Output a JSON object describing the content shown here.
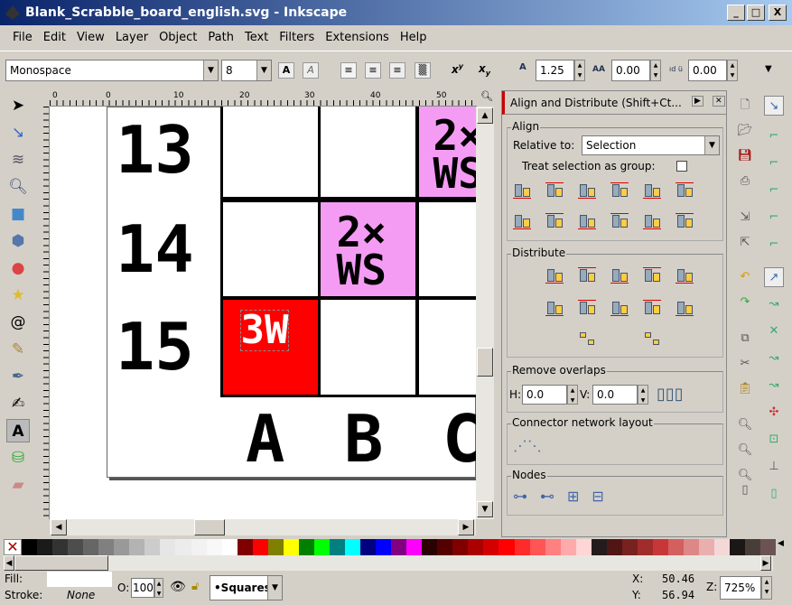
{
  "window": {
    "title": "Blank_Scrabble_board_english.svg - Inkscape",
    "min": "_",
    "max": "□",
    "close": "X"
  },
  "menu": [
    "File",
    "Edit",
    "View",
    "Layer",
    "Object",
    "Path",
    "Text",
    "Filters",
    "Extensions",
    "Help"
  ],
  "text_toolbar": {
    "font_family": "Monospace",
    "font_size": "8",
    "line_spacing": "1.25",
    "letter_spacing": "0.00",
    "word_spacing": "0.00",
    "superscript": "x",
    "subscript": "x"
  },
  "ruler": [
    "0",
    "0",
    "10",
    "20",
    "30",
    "40",
    "50"
  ],
  "canvas": {
    "rows": [
      "13",
      "14",
      "15"
    ],
    "columns": [
      "A",
      "B",
      "C"
    ],
    "cells": {
      "r13c": {
        "line1": "2×",
        "line2": "WS"
      },
      "r14b": {
        "line1": "2×",
        "line2": "WS"
      },
      "r15a": "3W"
    },
    "colors": {
      "pink": "#f49cf4",
      "red": "#ff0000"
    }
  },
  "dock": {
    "title": "Align and Distribute (Shift+Ct...",
    "align_label": "Align",
    "relative_to_label": "Relative to:",
    "relative_to_value": "Selection",
    "group_label": "Treat selection as group:",
    "distribute_label": "Distribute",
    "overlaps_label": "Remove overlaps",
    "h_label": "H:",
    "h_value": "0.0",
    "v_label": "V:",
    "v_value": "0.0",
    "connector_label": "Connector network layout",
    "nodes_label": "Nodes"
  },
  "palette": [
    "#000000",
    "#1a1a1a",
    "#333333",
    "#4d4d4d",
    "#666666",
    "#808080",
    "#999999",
    "#b3b3b3",
    "#cccccc",
    "#e6e6e6",
    "#ececec",
    "#f2f2f2",
    "#f8f8f8",
    "#ffffff",
    "#800000",
    "#ff0000",
    "#808000",
    "#ffff00",
    "#008000",
    "#00ff00",
    "#008080",
    "#00ffff",
    "#000080",
    "#0000ff",
    "#800080",
    "#ff00ff",
    "#2b0000",
    "#550000",
    "#800000",
    "#aa0000",
    "#d40000",
    "#ff0000",
    "#ff2a2a",
    "#ff5555",
    "#ff8080",
    "#ffaaaa",
    "#ffd5d5",
    "#241c1c",
    "#501616",
    "#782121",
    "#a02c2c",
    "#c83737",
    "#d35f5f",
    "#de8787",
    "#e9afaf",
    "#f4d7d7",
    "#1c1717",
    "#483e37",
    "#6c5353"
  ],
  "status": {
    "fill_label": "Fill:",
    "fill_color": "#ffffff",
    "stroke_label": "Stroke:",
    "stroke_value": "None",
    "opacity_label": "O:",
    "opacity_value": "100",
    "layer": "•Squares",
    "x_label": "X:",
    "x_value": "50.46",
    "y_label": "Y:",
    "y_value": "56.94",
    "zoom_label": "Z:",
    "zoom_value": "725%"
  }
}
